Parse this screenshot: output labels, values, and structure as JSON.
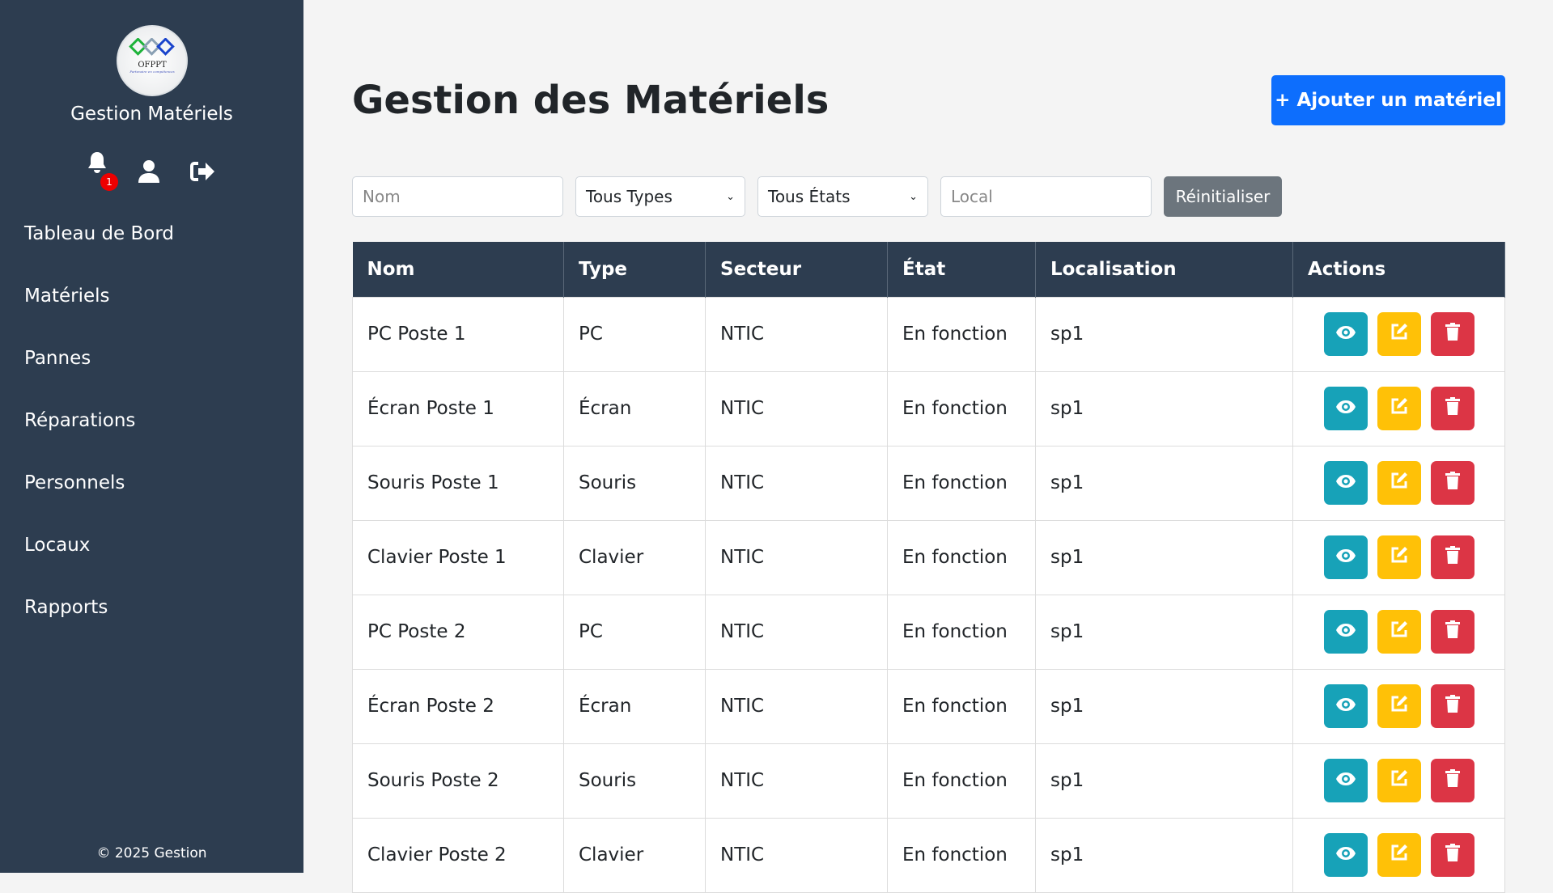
{
  "sidebar": {
    "logo_text": "OFPPT",
    "logo_tagline": "Partenaire en compétences",
    "brand": "Gestion Matériels",
    "notification_count": "1",
    "nav": [
      "Tableau de Bord",
      "Matériels",
      "Pannes",
      "Réparations",
      "Personnels",
      "Locaux",
      "Rapports"
    ],
    "footer": "© 2025 Gestion"
  },
  "main": {
    "title": "Gestion des Matériels",
    "add_button": "+ Ajouter un matériel",
    "filters": {
      "nom_placeholder": "Nom",
      "type_selected": "Tous Types",
      "etat_selected": "Tous États",
      "local_placeholder": "Local",
      "reset": "Réinitialiser"
    },
    "columns": [
      "Nom",
      "Type",
      "Secteur",
      "État",
      "Localisation",
      "Actions"
    ],
    "rows": [
      [
        "PC Poste 1",
        "PC",
        "NTIC",
        "En fonction",
        "sp1"
      ],
      [
        "Écran Poste 1",
        "Écran",
        "NTIC",
        "En fonction",
        "sp1"
      ],
      [
        "Souris Poste 1",
        "Souris",
        "NTIC",
        "En fonction",
        "sp1"
      ],
      [
        "Clavier Poste 1",
        "Clavier",
        "NTIC",
        "En fonction",
        "sp1"
      ],
      [
        "PC Poste 2",
        "PC",
        "NTIC",
        "En fonction",
        "sp1"
      ],
      [
        "Écran Poste 2",
        "Écran",
        "NTIC",
        "En fonction",
        "sp1"
      ],
      [
        "Souris Poste 2",
        "Souris",
        "NTIC",
        "En fonction",
        "sp1"
      ],
      [
        "Clavier Poste 2",
        "Clavier",
        "NTIC",
        "En fonction",
        "sp1"
      ]
    ]
  },
  "colors": {
    "sidebar": "#2d3d50",
    "primary": "#0d6efd",
    "view": "#17a2b8",
    "edit": "#ffc107",
    "delete": "#dc3545"
  }
}
